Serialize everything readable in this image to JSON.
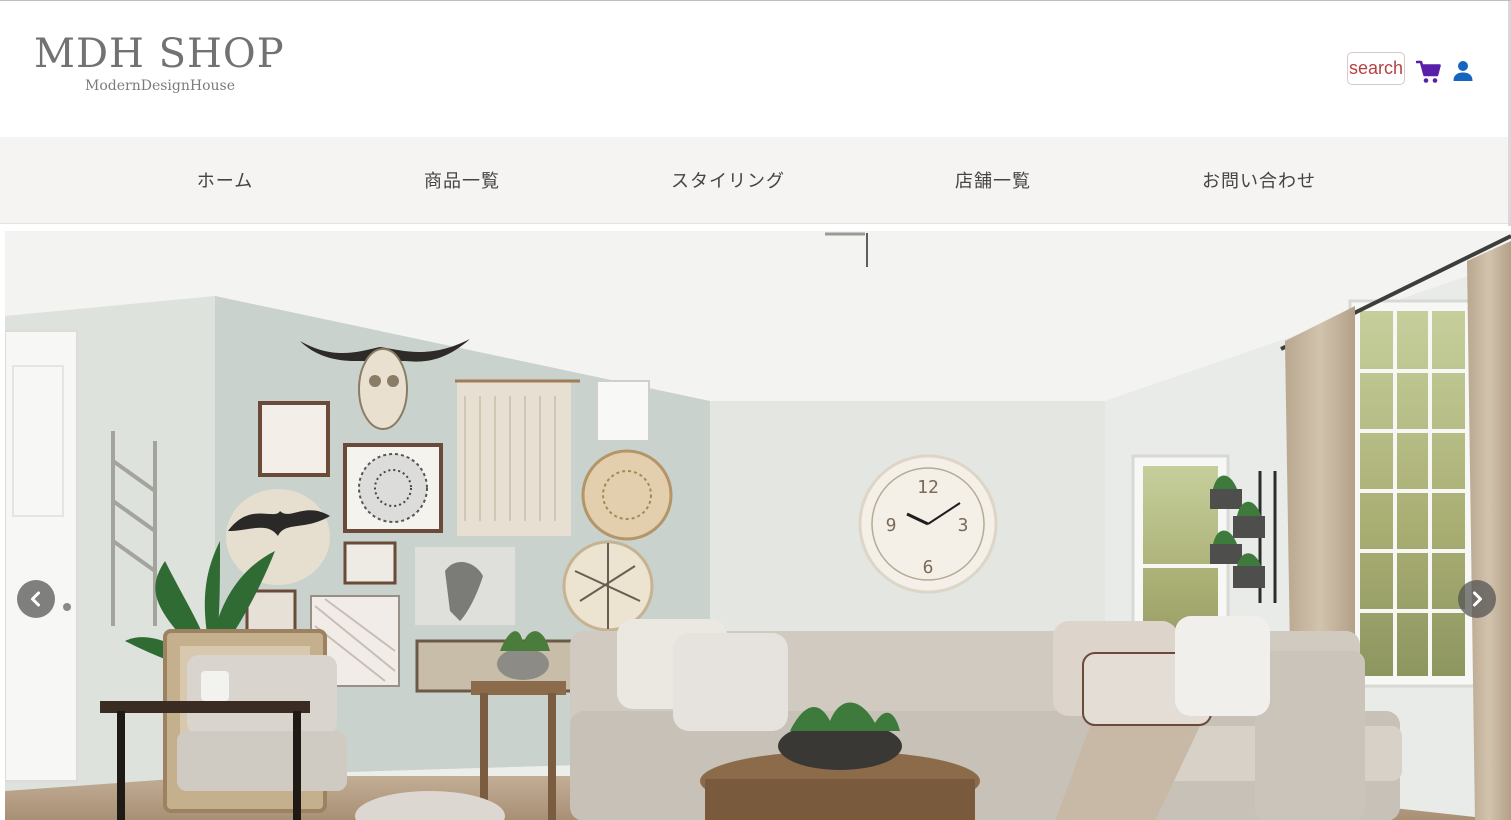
{
  "header": {
    "logo": {
      "title": "MDH SHOP",
      "subtitle": "ModernDesignHouse"
    },
    "search_label": "search",
    "icons": {
      "cart": "cart-icon",
      "user": "user-icon"
    }
  },
  "nav": {
    "items": [
      {
        "label": "ホーム"
      },
      {
        "label": "商品一覧"
      },
      {
        "label": "スタイリング"
      },
      {
        "label": "店舗一覧"
      },
      {
        "label": "お問い合わせ"
      }
    ]
  },
  "hero": {
    "clock_numbers": [
      "12",
      "3",
      "6",
      "9"
    ],
    "controls": {
      "prev": "chevron-left-icon",
      "next": "chevron-right-icon"
    }
  },
  "colors": {
    "cart": "#5a1fa8",
    "user": "#1565c0",
    "search_text": "#b44242",
    "nav_bg": "#f5f4f2"
  }
}
